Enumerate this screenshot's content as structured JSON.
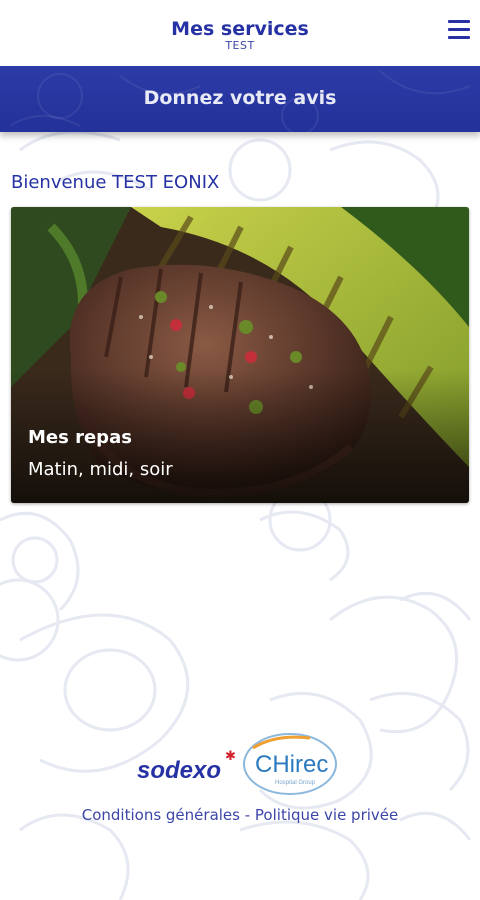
{
  "header": {
    "title": "Mes services",
    "subtitle": "TEST",
    "menu_icon": "hamburger-menu-icon"
  },
  "banner": {
    "label": "Donnez votre avis"
  },
  "welcome": {
    "text": "Bienvenue TEST EONIX"
  },
  "meal_card": {
    "title": "Mes repas",
    "subtitle": "Matin, midi, soir"
  },
  "logos": {
    "sodexo": "sodexo",
    "chirec": "CHirec",
    "chirec_tagline": "Hospital Group"
  },
  "footer": {
    "conditions": "Conditions générales",
    "separator": " - ",
    "privacy": "Politique vie privée"
  },
  "colors": {
    "primary": "#2632a3",
    "banner": "#2c3ba6",
    "background": "#ffffff"
  }
}
